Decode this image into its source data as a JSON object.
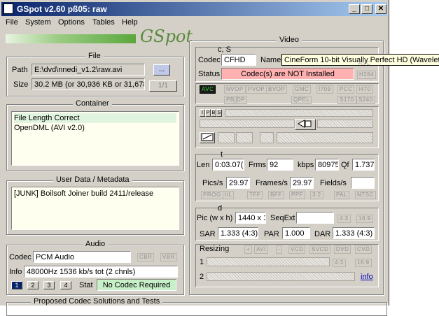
{
  "window": {
    "title": "GSpot v2.60 pß05: raw",
    "controls": [
      "_",
      "□",
      "✕"
    ]
  },
  "menu": [
    "File",
    "System",
    "Options",
    "Tables",
    "Help"
  ],
  "logo": "GSpot",
  "file": {
    "title": "File",
    "path_label": "Path",
    "path_value": "E:\\dvd\\nnedi_v1.2\\raw.avi",
    "browse": "...",
    "size_label": "Size",
    "size_value": "30.2 MB (or 30,936 KB or 31,678",
    "page": "1/1"
  },
  "container": {
    "title": "Container",
    "items": [
      "File Length Correct",
      "OpenDML (AVI v2.0)"
    ]
  },
  "userdata": {
    "title": "User Data / Metadata",
    "text": "[JUNK]  Boilsoft Joiner build 2411/release"
  },
  "audio": {
    "title": "Audio",
    "codec_label": "Codec",
    "codec_value": "PCM Audio",
    "cbr": "CBR",
    "vbr": "VBR",
    "info_label": "Info",
    "info_value": "48000Hz  1536 kb/s tot (2 chnls)",
    "streams": [
      "1",
      "2",
      "3",
      "4"
    ],
    "stat_label": "Stat",
    "stat_value": "No Codec Required",
    "stat_color": "#c8f0c8"
  },
  "proposed": {
    "title": "Proposed Codec Solutions and Tests"
  },
  "video": {
    "title": "Video",
    "cs_label": "c, S",
    "codec_label": "Codec",
    "codec_value": "CFHD",
    "name_label": "Name",
    "name_value": "CineForm 10-bit Visually Perfect HD (Wavelet)",
    "status_label": "Status",
    "status_value": "Codec(s) are NOT Installed",
    "status_color": "#ffb0b0",
    "h264": "H264",
    "avc": "AVC",
    "flags_row1": [
      "NVOP",
      "PVOP",
      "BVOP",
      "GMC",
      "I709",
      "PCC",
      "I470"
    ],
    "flags_row2": [
      "PB",
      "DP",
      "QPEL",
      "S170",
      "S240"
    ],
    "avc_badge": "AVC",
    "frame_buttons": [
      "I",
      "P",
      "B",
      "S"
    ],
    "t_label": "t",
    "len_label": "Len",
    "len_value": "0:03.07(",
    "frms_label": "Frms",
    "frms_value": "92",
    "kbps_label": "kbps",
    "kbps_value": "80975",
    "qf_label": "Qf",
    "qf_value": "1.737",
    "pics_label": "Pics/s",
    "pics_value": "29.97",
    "frames_label": "Frames/s",
    "frames_value": "29.97",
    "fields_label": "Fields/s",
    "flags_row3": [
      "PROG",
      "I/L",
      "TFF",
      "BFF",
      "PPF",
      "3:2",
      "PAL",
      "NTSC"
    ],
    "d_label": "d",
    "pic_label": "Pic (w x h)",
    "pic_value": "1440 x 1",
    "seqext_label": "SeqExt",
    "ar1": "4:3",
    "ar2": "16:9",
    "sar_label": "SAR",
    "sar_value": "1.333 (4:3)",
    "par_label": "PAR",
    "par_value": "1.000",
    "dar_label": "DAR",
    "dar_value": "1.333 (4:3)",
    "resizing_label": "Resizing",
    "resize_buttons": [
      "+",
      "AVI",
      "-",
      "VCD",
      "SVCD",
      "DVD",
      "CVD"
    ],
    "res_row1": "1",
    "res_row2": "2",
    "res_ar1": "4:3",
    "res_ar2": "16:9",
    "info_link": "info"
  }
}
